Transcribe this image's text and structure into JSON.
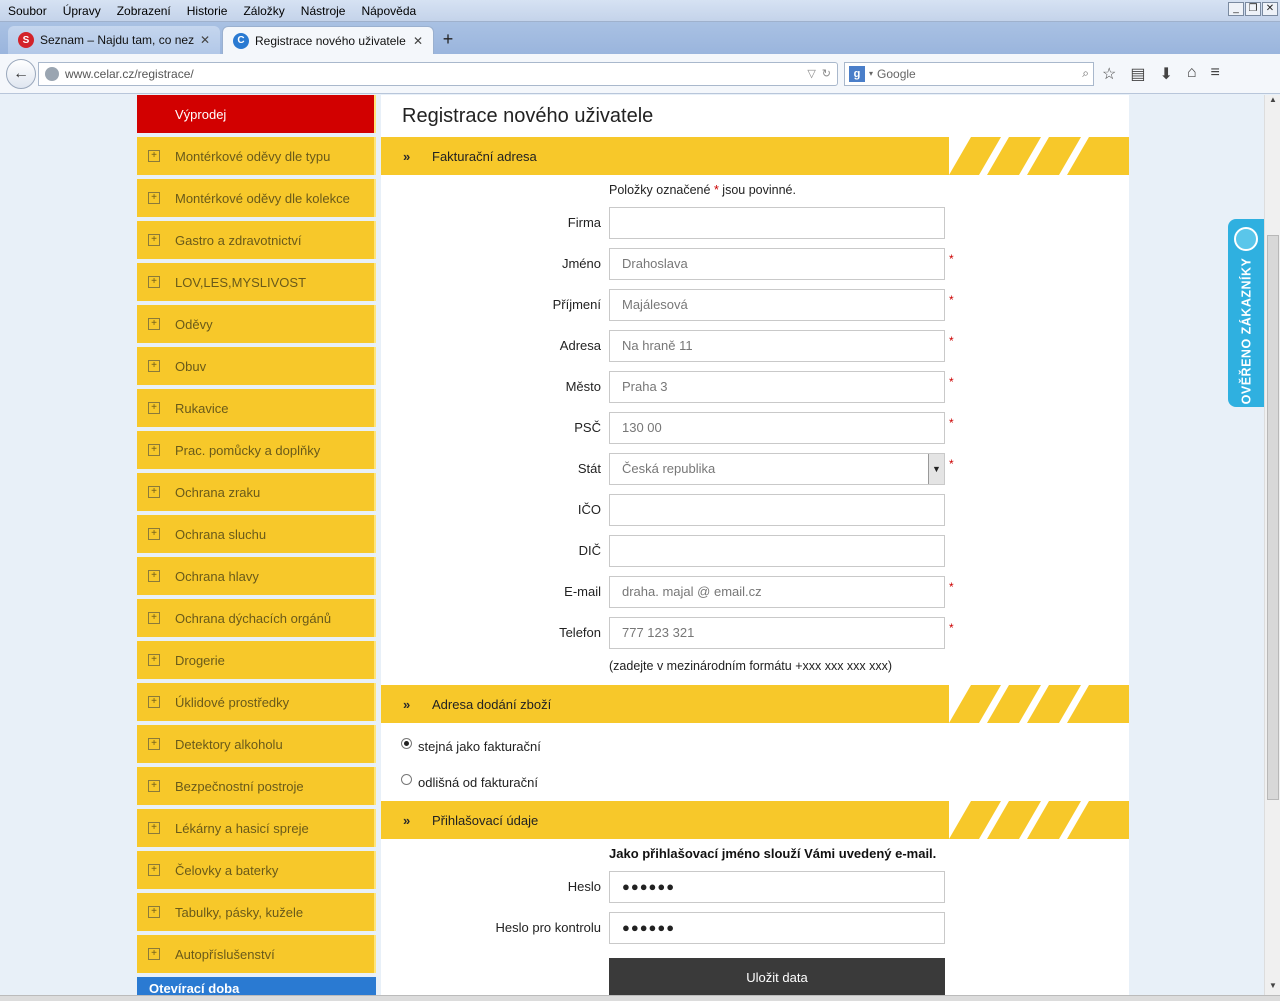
{
  "browser": {
    "menu": [
      "Soubor",
      "Úpravy",
      "Zobrazení",
      "Historie",
      "Záložky",
      "Nástroje",
      "Nápověda"
    ],
    "tabs": [
      {
        "title": "Seznam – Najdu tam, co nezn...",
        "favicon": "S"
      },
      {
        "title": "Registrace nového uživatele -...",
        "favicon": "C"
      }
    ],
    "url": "www.celar.cz/registrace/",
    "search_placeholder": "Google"
  },
  "sidebar": {
    "sale": "Výprodej",
    "items": [
      "Montérkové oděvy dle typu",
      "Montérkové oděvy dle kolekce",
      "Gastro a zdravotnictví",
      "LOV,LES,MYSLIVOST",
      "Oděvy",
      "Obuv",
      "Rukavice",
      "Prac. pomůcky a doplňky",
      "Ochrana zraku",
      "Ochrana sluchu",
      "Ochrana hlavy",
      "Ochrana dýchacích orgánů",
      "Drogerie",
      "Úklidové prostředky",
      "Detektory alkoholu",
      "Bezpečnostní postroje",
      "Lékárny a hasicí spreje",
      "Čelovky a baterky",
      "Tabulky, pásky, kužele",
      "Autopříslušenství"
    ],
    "bottom": "Otevírací doba"
  },
  "main": {
    "title": "Registrace nového uživatele",
    "billing_section": "Fakturační adresa",
    "required_note_prefix": "Položky označené",
    "required_note_star": "*",
    "required_note_suffix": "jsou povinné.",
    "fields": {
      "firma": {
        "label": "Firma",
        "value": ""
      },
      "jmeno": {
        "label": "Jméno",
        "value": "Drahoslava"
      },
      "prijmeni": {
        "label": "Příjmení",
        "value": "Majálesová"
      },
      "adresa": {
        "label": "Adresa",
        "value": "Na hraně 11"
      },
      "mesto": {
        "label": "Město",
        "value": "Praha 3"
      },
      "psc": {
        "label": "PSČ",
        "value": "130 00"
      },
      "stat": {
        "label": "Stát",
        "value": "Česká republika"
      },
      "ico": {
        "label": "IČO",
        "value": ""
      },
      "dic": {
        "label": "DIČ",
        "value": ""
      },
      "email": {
        "label": "E-mail",
        "value": "draha. majal @ email.cz"
      },
      "telefon": {
        "label": "Telefon",
        "value": "777 123 321"
      }
    },
    "phone_hint": "(zadejte v mezinárodním formátu +xxx xxx xxx xxx)",
    "delivery_section": "Adresa dodání zboží",
    "delivery_same": "stejná jako fakturační",
    "delivery_diff": "odlišná od fakturační",
    "login_section": "Přihlašovací údaje",
    "login_note": "Jako přihlašovací jméno slouží Vámi uvedený e-mail.",
    "heslo": {
      "label": "Heslo",
      "value": "●●●●●●"
    },
    "heslo2": {
      "label": "Heslo pro kontrolu",
      "value": "●●●●●●"
    },
    "save": "Uložit data",
    "star": "*",
    "section_arrows": "»"
  },
  "badge": "OVĚŘENO ZÁKAZNÍKY",
  "colors": {
    "yellow": "#f7c82a",
    "red": "#d20000",
    "blue": "#2a7ad2",
    "badge": "#2fb0e0"
  }
}
